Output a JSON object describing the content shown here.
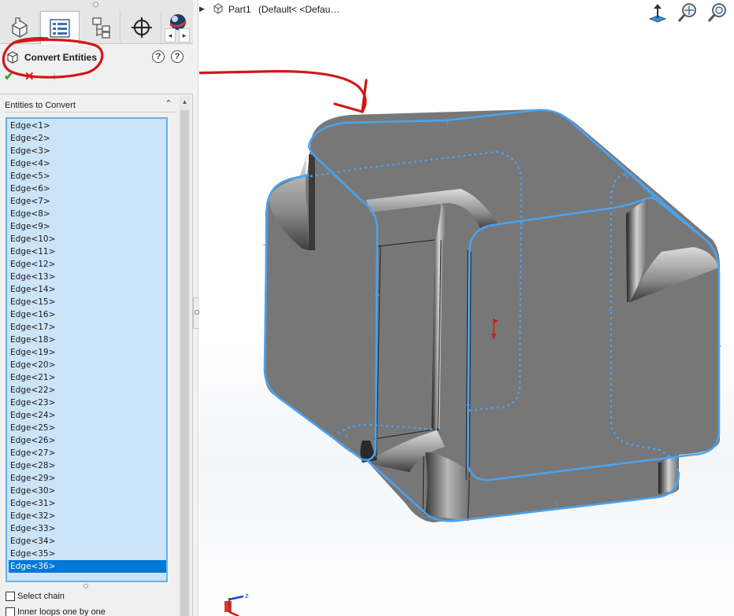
{
  "property_manager": {
    "title": "Convert Entities",
    "section_title": "Entities to Convert",
    "edges": [
      "Edge<1>",
      "Edge<2>",
      "Edge<3>",
      "Edge<4>",
      "Edge<5>",
      "Edge<6>",
      "Edge<7>",
      "Edge<8>",
      "Edge<9>",
      "Edge<10>",
      "Edge<11>",
      "Edge<12>",
      "Edge<13>",
      "Edge<14>",
      "Edge<15>",
      "Edge<16>",
      "Edge<17>",
      "Edge<18>",
      "Edge<19>",
      "Edge<20>",
      "Edge<21>",
      "Edge<22>",
      "Edge<23>",
      "Edge<24>",
      "Edge<25>",
      "Edge<26>",
      "Edge<27>",
      "Edge<28>",
      "Edge<29>",
      "Edge<30>",
      "Edge<31>",
      "Edge<32>",
      "Edge<33>",
      "Edge<34>",
      "Edge<35>",
      "Edge<36>"
    ],
    "selected_edge": "Edge<36>",
    "options": [
      "Select chain",
      "Inner loops one by one"
    ],
    "help_glyph": "?"
  },
  "tabs": [
    "feature-manager-icon",
    "property-manager-icon",
    "configuration-manager-icon",
    "dimxpert-icon",
    "appearance-icon"
  ],
  "tab_scroll": {
    "left": "◂",
    "right": "▸"
  },
  "viewport": {
    "part_name": "Part1",
    "config": "(Default< <Defau…",
    "tools": [
      "normal-to-icon",
      "zoom-to-fit-icon",
      "zoom-to-area-icon"
    ],
    "triad_axis_label": "z"
  },
  "colors": {
    "selection_blue": "#4aa3f0",
    "face_gray": "#787878",
    "annotation_red": "#d01818",
    "list_bg": "#cce4f7",
    "list_selected": "#0078d7"
  }
}
